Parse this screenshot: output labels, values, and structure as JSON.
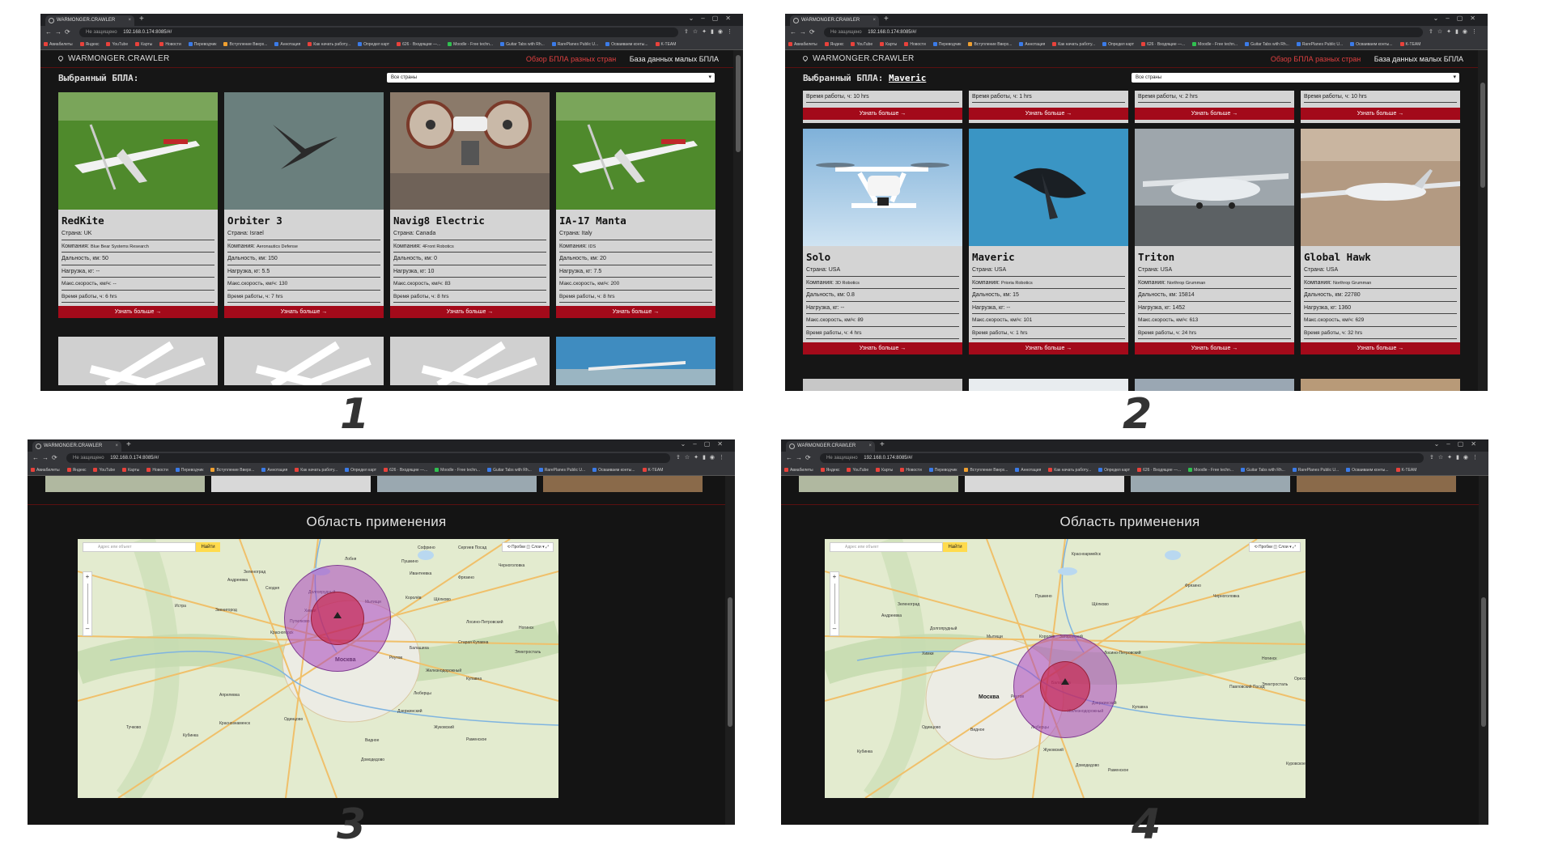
{
  "browser": {
    "tab_title": "WARMONGER.CRAWLER",
    "url_security": "Не защищено",
    "url": "192.168.0.174:8085/#/",
    "bookmarks": [
      {
        "label": "Авиабилеты",
        "color": "#e8423b"
      },
      {
        "label": "Яндекс",
        "color": "#e8423b"
      },
      {
        "label": "YouTube",
        "color": "#e8423b"
      },
      {
        "label": "Карты",
        "color": "#e8423b"
      },
      {
        "label": "Новости",
        "color": "#e8423b"
      },
      {
        "label": "Переводчик",
        "color": "#3b7be8"
      },
      {
        "label": "Вступление Вверх...",
        "color": "#f0a030"
      },
      {
        "label": "Аннотация",
        "color": "#3b7be8"
      },
      {
        "label": "Как начать работу...",
        "color": "#e8423b"
      },
      {
        "label": "Определ карт",
        "color": "#3b7be8"
      },
      {
        "label": "626 · Входящие —...",
        "color": "#e8423b"
      },
      {
        "label": "Moodle - Free techn...",
        "color": "#30c050"
      },
      {
        "label": "Guitar Tabs with Rh...",
        "color": "#3b7be8"
      },
      {
        "label": "RarePlanes Public U...",
        "color": "#3b7be8"
      },
      {
        "label": "Осваиваем конты...",
        "color": "#3b7be8"
      },
      {
        "label": "K-TEAM",
        "color": "#e8423b"
      }
    ]
  },
  "site": {
    "logo": "WARMONGER.CRAWLER",
    "nav_overview": "Обзор БПЛА разных стран",
    "nav_database": "База данных малых БПЛА",
    "selected_label": "Выбранный БПЛА:",
    "selected_name": "Maveric",
    "country_filter": "Все страны",
    "learn_more": "Узнать больше →",
    "map_title": "Область применения"
  },
  "labels": {
    "country": "Страна:",
    "company": "Компания:",
    "range": "Дальность, км:",
    "payload": "Нагрузка, кг:",
    "speed": "Макс.скорость, км/ч:",
    "endurance": "Время работы, ч:"
  },
  "drones_page1": [
    {
      "name": "RedKite",
      "country": "UK",
      "company": "Blue Bear Systems Research",
      "range": "50",
      "payload": "--",
      "speed": "--",
      "endurance": "6 hrs",
      "photo": "white fixed-wing drone on green grass"
    },
    {
      "name": "Orbiter 3",
      "country": "Israel",
      "company": "Aeronautics Defense",
      "range": "150",
      "payload": "5.5",
      "speed": "130",
      "endurance": "7 hrs",
      "photo": "flying wing on grey sky"
    },
    {
      "name": "Navig8 Electric",
      "country": "Canada",
      "company": "4Front Robotics",
      "range": "0",
      "payload": "10",
      "speed": "83",
      "endurance": "8 hrs",
      "photo": "quad-fan drone in workshop"
    },
    {
      "name": "IA-17 Manta",
      "country": "Italy",
      "company": "IDS",
      "range": "20",
      "payload": "7.5",
      "speed": "200",
      "endurance": "8 hrs",
      "photo": "white fixed-wing drone on green grass"
    }
  ],
  "drones_page2_top_endurance": [
    "10 hrs",
    "1 hrs",
    "2 hrs",
    "10 hrs"
  ],
  "drones_page2": [
    {
      "name": "Solo",
      "country": "USA",
      "company": "3D Robotics",
      "range": "0.8",
      "payload": "--",
      "speed": "89",
      "endurance": "4 hrs",
      "photo": "white quadcopter on sky"
    },
    {
      "name": "Maveric",
      "country": "USA",
      "company": "Prioria Robotics",
      "range": "15",
      "payload": "--",
      "speed": "101",
      "endurance": "1 hrs",
      "photo": "dark drone on blue sky"
    },
    {
      "name": "Triton",
      "country": "USA",
      "company": "Northrop Grumman",
      "range": "15814",
      "payload": "1452",
      "speed": "613",
      "endurance": "24 hrs",
      "photo": "large grey drone on runway"
    },
    {
      "name": "Global Hawk",
      "country": "USA",
      "company": "Northrop Grumman",
      "range": "22780",
      "payload": "1360",
      "speed": "629",
      "endurance": "32 hrs",
      "photo": "large drone flying over desert"
    }
  ],
  "map_ui": {
    "search_placeholder": "Адрес или объект",
    "find_button": "Найти",
    "tools": "⟲ Пробки  ◫ Слои ▾  ⤢",
    "zoom_plus": "+",
    "zoom_minus": "–"
  },
  "map3_places": [
    {
      "t": "Зеленоград",
      "big": false
    },
    {
      "t": "Андреевка",
      "big": false
    },
    {
      "t": "Сходня",
      "big": false
    },
    {
      "t": "Долгопрудный",
      "big": false
    },
    {
      "t": "Химки",
      "big": false
    },
    {
      "t": "Мытищи",
      "big": false
    },
    {
      "t": "Королёв",
      "big": false
    },
    {
      "t": "Щёлково",
      "big": false
    },
    {
      "t": "Путилково",
      "big": false
    },
    {
      "t": "Красногорск",
      "big": false
    },
    {
      "t": "Москва",
      "big": true
    },
    {
      "t": "Балашиха",
      "big": false
    },
    {
      "t": "Реутов",
      "big": false
    },
    {
      "t": "Люберцы",
      "big": false
    },
    {
      "t": "Пушкино",
      "big": false
    },
    {
      "t": "Лобня",
      "big": false
    },
    {
      "t": "Истра",
      "big": false
    },
    {
      "t": "Одинцово",
      "big": false
    },
    {
      "t": "Ногинск",
      "big": false
    },
    {
      "t": "Электросталь",
      "big": false
    },
    {
      "t": "Жуковский",
      "big": false
    },
    {
      "t": "Видное",
      "big": false
    },
    {
      "t": "Домодедово",
      "big": false
    },
    {
      "t": "Раменское",
      "big": false
    },
    {
      "t": "Апрелевка",
      "big": false
    },
    {
      "t": "Краснознаменск",
      "big": false
    },
    {
      "t": "Кубинка",
      "big": false
    },
    {
      "t": "Черноголовка",
      "big": false
    },
    {
      "t": "Фрязино",
      "big": false
    },
    {
      "t": "Ивантеевка",
      "big": false
    },
    {
      "t": "Звенигород",
      "big": false
    },
    {
      "t": "Дзержинский",
      "big": false
    },
    {
      "t": "Железнодорожный",
      "big": false
    },
    {
      "t": "Купавна",
      "big": false
    },
    {
      "t": "Старая Купавна",
      "big": false
    },
    {
      "t": "Лосино-Петровский",
      "big": false
    },
    {
      "t": "Софрино",
      "big": false
    },
    {
      "t": "Сергиев Посад",
      "big": false
    },
    {
      "t": "Тучково",
      "big": false
    }
  ],
  "map4_places": [
    {
      "t": "Софрино",
      "big": false
    },
    {
      "t": "Красноармейск",
      "big": false
    },
    {
      "t": "Фряново",
      "big": false
    },
    {
      "t": "Пушкино",
      "big": false
    },
    {
      "t": "Зеленоград",
      "big": false
    },
    {
      "t": "Андреевка",
      "big": false
    },
    {
      "t": "Долгопрудный",
      "big": false
    },
    {
      "t": "Мытищи",
      "big": false
    },
    {
      "t": "Королёв",
      "big": false
    },
    {
      "t": "Химки",
      "big": false
    },
    {
      "t": "Щёлково",
      "big": false
    },
    {
      "t": "Москва",
      "big": true
    },
    {
      "t": "Балашиха",
      "big": false
    },
    {
      "t": "Реутов",
      "big": false
    },
    {
      "t": "Железнодорожный",
      "big": false
    },
    {
      "t": "Люберцы",
      "big": false
    },
    {
      "t": "Ногинск",
      "big": false
    },
    {
      "t": "Электросталь",
      "big": false
    },
    {
      "t": "Жуковский",
      "big": false
    },
    {
      "t": "Раменское",
      "big": false
    },
    {
      "t": "Одинцово",
      "big": false
    },
    {
      "t": "Купавна",
      "big": false
    },
    {
      "t": "Загорянский",
      "big": false
    },
    {
      "t": "Лосино-Петровский",
      "big": false
    },
    {
      "t": "Черноголовка",
      "big": false
    },
    {
      "t": "Фрязино",
      "big": false
    },
    {
      "t": "Орехово-Зуево",
      "big": false
    },
    {
      "t": "Павловский Посад",
      "big": false
    },
    {
      "t": "Кубинка",
      "big": false
    },
    {
      "t": "Дзержинский",
      "big": false
    },
    {
      "t": "Видное",
      "big": false
    },
    {
      "t": "Домодедово",
      "big": false
    },
    {
      "t": "Куровское",
      "big": false
    }
  ],
  "figure_numbers": [
    "1",
    "2",
    "3",
    "4"
  ],
  "accent_color": "#a30a1a"
}
